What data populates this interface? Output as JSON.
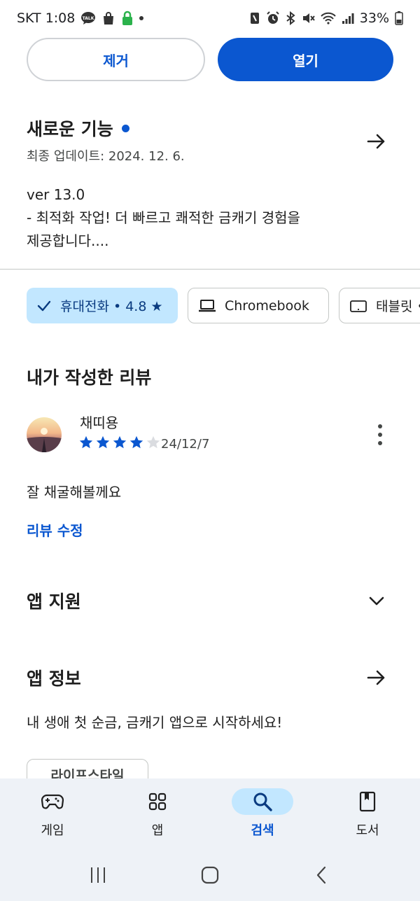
{
  "status_bar": {
    "carrier_time": "SKT 1:08",
    "battery": "33%"
  },
  "actions": {
    "remove": "제거",
    "open": "열기"
  },
  "whats_new": {
    "title": "새로운 기능",
    "updated": "최종 업데이트: 2024. 12. 6.",
    "lines": [
      "ver 13.0",
      "- 최적화 작업! 더 빠르고 쾌적한 금캐기 경험을",
      "제공합니다...."
    ]
  },
  "device_chips": [
    {
      "label": "휴대전화 • 4.8 ★",
      "selected": true
    },
    {
      "label": "Chromebook",
      "selected": false
    },
    {
      "label": "태블릿 •",
      "selected": false
    }
  ],
  "my_review": {
    "section_title": "내가 작성한 리뷰",
    "author": "채띠용",
    "rating": 4,
    "max_rating": 5,
    "date": "24/12/7",
    "text": "잘 채굴해볼께요",
    "edit_label": "리뷰 수정"
  },
  "app_support": {
    "title": "앱 지원"
  },
  "app_info": {
    "title": "앱 정보",
    "description": "내 생애 첫 순금, 금캐기 앱으로 시작하세요!",
    "tag": "라이프스타일"
  },
  "bottom_nav": [
    {
      "label": "게임",
      "icon": "gamepad-icon",
      "active": false
    },
    {
      "label": "앱",
      "icon": "apps-grid-icon",
      "active": false
    },
    {
      "label": "검색",
      "icon": "search-icon",
      "active": true
    },
    {
      "label": "도서",
      "icon": "book-icon",
      "active": false
    }
  ],
  "colors": {
    "accent": "#0b57d0",
    "chip_selected_bg": "#c2e7ff",
    "nav_bg": "#eef2f7"
  }
}
